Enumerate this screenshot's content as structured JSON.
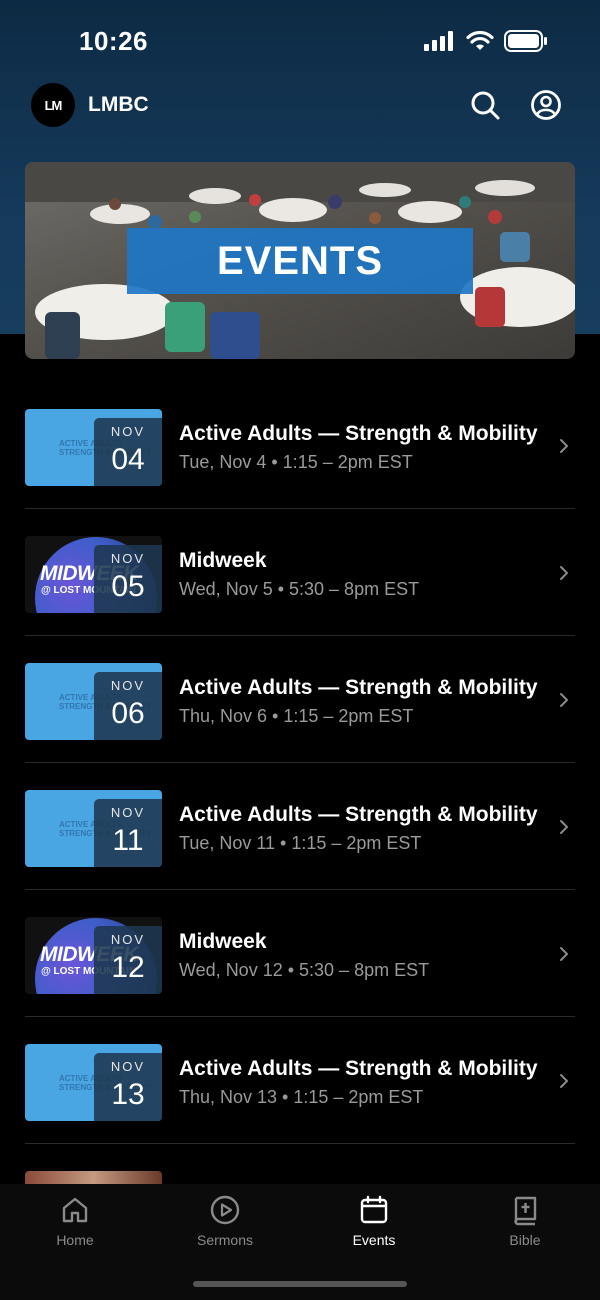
{
  "status_bar": {
    "time": "10:26"
  },
  "header": {
    "title": "LMBC",
    "logo_letters": "LM"
  },
  "banner": {
    "label": "EVENTS"
  },
  "events": [
    {
      "thumb": "active-adults",
      "month": "NOV",
      "day": "04",
      "title": "Active Adults — Strength & Mobility",
      "when": "Tue, Nov 4 • 1:15 – 2pm EST"
    },
    {
      "thumb": "midweek",
      "month": "NOV",
      "day": "05",
      "title": "Midweek",
      "when": "Wed, Nov 5 • 5:30 – 8pm EST"
    },
    {
      "thumb": "active-adults",
      "month": "NOV",
      "day": "06",
      "title": "Active Adults — Strength & Mobility",
      "when": "Thu, Nov 6 • 1:15 – 2pm EST"
    },
    {
      "thumb": "active-adults",
      "month": "NOV",
      "day": "11",
      "title": "Active Adults — Strength & Mobility",
      "when": "Tue, Nov 11 • 1:15 – 2pm EST"
    },
    {
      "thumb": "midweek",
      "month": "NOV",
      "day": "12",
      "title": "Midweek",
      "when": "Wed, Nov 12 • 5:30 – 8pm EST"
    },
    {
      "thumb": "active-adults",
      "month": "NOV",
      "day": "13",
      "title": "Active Adults — Strength & Mobility",
      "when": "Thu, Nov 13 • 1:15 – 2pm EST"
    }
  ],
  "thumb_text": {
    "active_line1": "ACTIVE ADULTS",
    "active_line2": "STRENGTH & MOBILITY",
    "midweek_line1": "MIDWEEK",
    "midweek_line2": "@ LOST MOUNTAIN"
  },
  "tabs": [
    {
      "label": "Home",
      "icon": "home-icon",
      "selected": false
    },
    {
      "label": "Sermons",
      "icon": "play-circle-icon",
      "selected": false
    },
    {
      "label": "Events",
      "icon": "calendar-icon",
      "selected": true
    },
    {
      "label": "Bible",
      "icon": "bible-icon",
      "selected": false
    }
  ],
  "colors": {
    "accent": "#1e76c4",
    "header_bg": "#15395a",
    "thumb_blue": "#4aa5e3"
  }
}
